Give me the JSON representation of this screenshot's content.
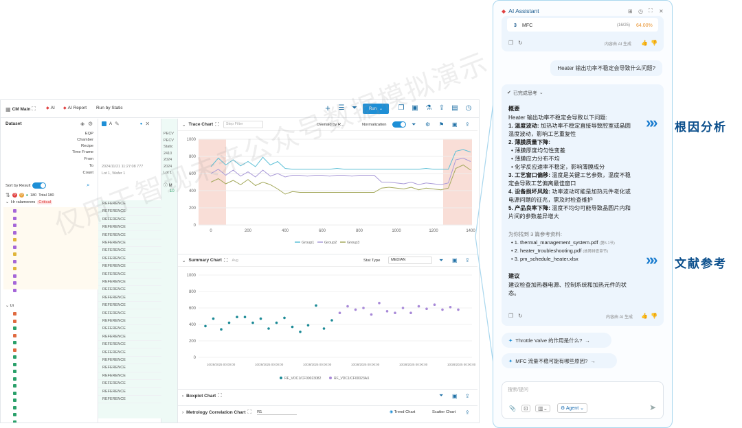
{
  "app": {
    "title": "CM Main",
    "ai_tab": "AI",
    "ai_report": "AI Report",
    "run_by": "Run by Static",
    "run": "Run"
  },
  "dataset": {
    "title": "Dataset",
    "fields": [
      "EQP",
      "Chamber",
      "Recipe",
      "Time Frame",
      "From",
      "To",
      "Count"
    ],
    "sort": "Sort by Result",
    "counts": {
      "a": "0",
      "b": "0",
      "c": "180",
      "total": "Total 180"
    },
    "group1": "Hr ralamerers",
    "group1_badge": "Critical",
    "group2": "Ui"
  },
  "col2": {
    "label": "A",
    "meta1": "2024/11/21 11:27:08 777",
    "meta2": "Lot 1, Wafer 1",
    "rows": [
      "REFERENCE",
      "REFERENCE",
      "REFERENCE",
      "REFERENCE",
      "REFERENCE",
      "REFERENCE",
      "REFERENCE",
      "REFERENCE",
      "REFERENCE",
      "REFERENCE",
      "REFERENCE",
      "REFERENCE",
      "REFERENCE",
      "REFERENCE",
      "REFERENCE",
      "REFERENCE",
      "REFERENCE",
      "REFERENCE",
      "REFERENCE",
      "REFERENCE",
      "REFERENCE",
      "REFERENCE",
      "REFERENCE",
      "REFERENCE",
      "REFERENCE",
      "REFERENCE"
    ]
  },
  "col3": {
    "lines": [
      "PECV",
      "PECV",
      "Static",
      "2410",
      "2024",
      "2024",
      "Lot 1"
    ],
    "m": "M",
    "v": "10"
  },
  "trace": {
    "title": "Trace Chart",
    "step": "Step Filter",
    "overlaid": "Overlaid by R...",
    "normalization": "Normalization",
    "legend": [
      "Group1",
      "Group2",
      "Group3"
    ]
  },
  "summary": {
    "title": "Summary Chart",
    "sub": "Avg",
    "stat_type": "Stat Type",
    "stat_value": "MEDIAN",
    "legend": [
      "RF_VOC1/CF00023082",
      "RF_VDC1/CF00023AX"
    ],
    "xlabels": [
      "10/28/2025 00:00:00",
      "10/28/2025 00:00:00",
      "10/28/2025 00:00:00",
      "10/28/2025 00:00:00",
      "10/28/2025 00:00:00",
      "10/28/2025 00:00:00"
    ]
  },
  "boxplot": {
    "title": "Boxplot Chart"
  },
  "metrology": {
    "title": "Metrology Correlation Chart",
    "sel": "R1",
    "trend": "Trend Chart",
    "scatter": "Scatter Chart"
  },
  "ai": {
    "title": "AI Assistant",
    "prev": {
      "idx": "3",
      "name": "MFC",
      "count": "(16/25)",
      "pct": "64.00%",
      "gen": "内容由 AI 生成"
    },
    "question": "Heater 输出功率不稳定会导致什么问题?",
    "thinking": "已完成思考",
    "answer": {
      "h1": "概要",
      "intro": "Heater 输出功率不稳定会导致以下问题:",
      "p1a": "1. 温度波动:",
      "p1b": "加热功率不稳定直接导致腔室或晶圆",
      "p1c": "温度波动，影响工艺重复性",
      "p2": "2. 薄膜质量下降:",
      "b1": "薄膜厚度均匀性变差",
      "b2": "薄膜应力分布不均",
      "b3": "化学反应速率不稳定，影响薄膜成分",
      "p3a": "3. 工艺窗口偏移:",
      "p3b": "温度是关键工艺参数，温度不稳",
      "p3c": "定会导致工艺偏离最佳窗口",
      "p4a": "4. 设备损坏风险:",
      "p4b": "功率波动可能是加热元件老化或",
      "p4c": "电源问题的征兆，需及时检查维护",
      "p5a": "5. 产品良率下降:",
      "p5b": "温度不均匀可能导致晶圆片内和",
      "p5c": "片间的参数差异增大",
      "refs_title": "为你找到 3 篇参考资料:",
      "refs": [
        "1. thermal_management_system.pdf",
        "2. heater_troubleshooting.pdf",
        "3. pm_schedule_heater.xlsx"
      ],
      "ref_notes": [
        "(第5.1节)",
        "(故障排查章节)"
      ],
      "h2": "建议",
      "sug1": "建议检查加热器电源、控制系统和加热元件的状",
      "sug2": "态。",
      "gen": "内容由 AI 生成"
    },
    "suggestions": [
      "Throttle Valve 的作用是什么?",
      "MFC 流量不稳可能有哪些原因?"
    ],
    "input_placeholder": "搜索/提问",
    "agent": "Agent"
  },
  "tags": {
    "root": "根因分析",
    "ref": "文献参考"
  },
  "watermark": "仅用于智现未来公众号数据模拟演示",
  "colors": {
    "accent": "#1e8fd6",
    "group1": "#5bbfd6",
    "group2": "#a99ad8",
    "group3": "#a3a85a",
    "shade": "#f7d3ca",
    "teal": "#1c8a96",
    "purple": "#a889d8"
  },
  "chart_data": [
    {
      "type": "line",
      "title": "Trace Chart",
      "x_range": [
        0,
        1400
      ],
      "y_range": [
        0,
        1000
      ],
      "xticks": [
        0,
        200,
        400,
        600,
        800,
        1000,
        1200,
        1400
      ],
      "yticks": [
        0,
        200,
        400,
        600,
        800,
        1000
      ],
      "series": [
        {
          "name": "Group1",
          "x": [
            0,
            40,
            80,
            120,
            160,
            200,
            240,
            280,
            320,
            360,
            400,
            440,
            480,
            520,
            560,
            600,
            640,
            680,
            720,
            760,
            800,
            840,
            880,
            920,
            960,
            1000,
            1040,
            1080,
            1120,
            1160,
            1200,
            1240,
            1280,
            1320,
            1360,
            1400
          ],
          "y": [
            680,
            780,
            700,
            760,
            690,
            740,
            680,
            790,
            700,
            740,
            660,
            650,
            650,
            650,
            650,
            650,
            650,
            660,
            650,
            650,
            650,
            650,
            650,
            650,
            650,
            650,
            650,
            650,
            650,
            660,
            650,
            650,
            650,
            860,
            880,
            850
          ]
        },
        {
          "name": "Group2",
          "x": [
            0,
            40,
            80,
            120,
            160,
            200,
            240,
            280,
            320,
            360,
            400,
            440,
            480,
            520,
            560,
            600,
            640,
            680,
            720,
            760,
            800,
            840,
            880,
            920,
            960,
            1000,
            1040,
            1080,
            1120,
            1160,
            1200,
            1240,
            1280,
            1320,
            1360,
            1400
          ],
          "y": [
            600,
            650,
            580,
            640,
            570,
            620,
            560,
            640,
            570,
            600,
            560,
            580,
            580,
            570,
            580,
            580,
            570,
            580,
            580,
            570,
            580,
            580,
            580,
            500,
            500,
            490,
            480,
            500,
            470,
            490,
            480,
            470,
            490,
            760,
            780,
            740
          ]
        },
        {
          "name": "Group3",
          "x": [
            0,
            40,
            80,
            120,
            160,
            200,
            240,
            280,
            320,
            360,
            400,
            440,
            480,
            520,
            560,
            600,
            640,
            680,
            720,
            760,
            800,
            840,
            880,
            920,
            960,
            1000,
            1040,
            1080,
            1120,
            1160,
            1200,
            1240,
            1280,
            1320,
            1360,
            1400
          ],
          "y": [
            500,
            540,
            480,
            520,
            470,
            530,
            460,
            500,
            470,
            420,
            360,
            390,
            380,
            380,
            380,
            380,
            380,
            380,
            380,
            380,
            380,
            380,
            380,
            430,
            440,
            430,
            420,
            440,
            410,
            430,
            420,
            410,
            430,
            660,
            700,
            640
          ]
        }
      ]
    },
    {
      "type": "scatter",
      "title": "Summary Chart",
      "y_range": [
        0,
        1000
      ],
      "yticks": [
        0,
        200,
        400,
        600,
        800,
        1000
      ],
      "series": [
        {
          "name": "RF_VOC1/CF00023082",
          "x": [
            1,
            2,
            3,
            4,
            5,
            6,
            7,
            8,
            9,
            10,
            11,
            12,
            13,
            14,
            15,
            16,
            17
          ],
          "y": [
            380,
            470,
            340,
            420,
            490,
            490,
            420,
            470,
            350,
            420,
            480,
            370,
            310,
            390,
            630,
            350,
            450
          ]
        },
        {
          "name": "RF_VDC1/CF00023AX",
          "x": [
            18,
            19,
            20,
            21,
            22,
            23,
            24,
            25,
            26,
            27,
            28,
            29,
            30,
            31,
            32,
            33
          ],
          "y": [
            540,
            620,
            580,
            600,
            520,
            660,
            560,
            540,
            600,
            540,
            620,
            590,
            640,
            580,
            610,
            580
          ]
        }
      ]
    }
  ]
}
